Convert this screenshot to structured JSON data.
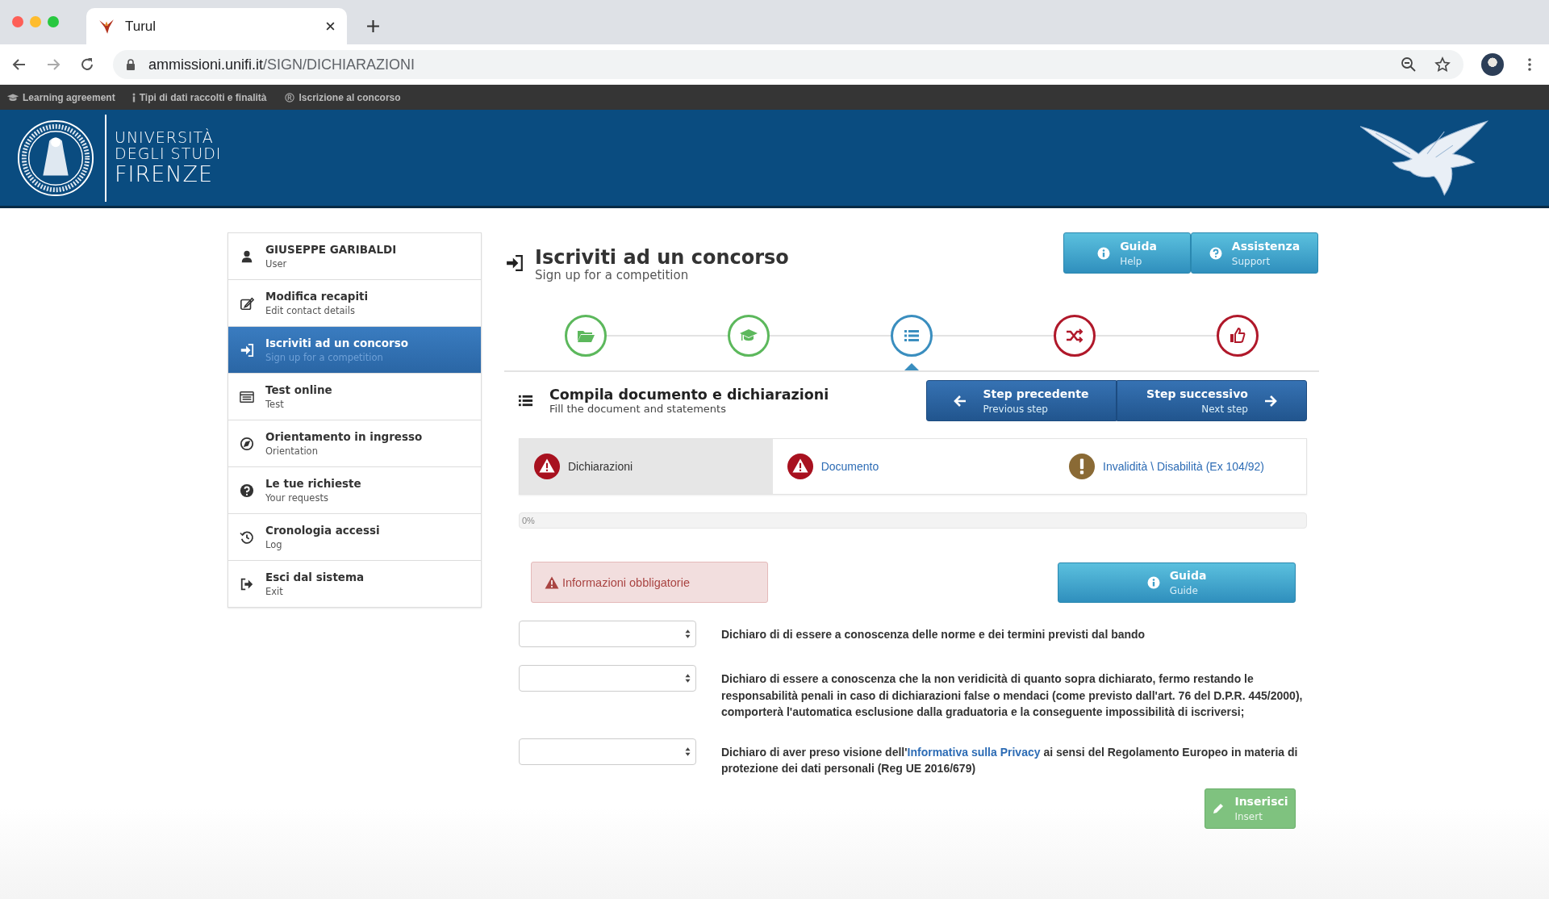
{
  "browser": {
    "tab_title": "Turul",
    "url_host": "ammissioni.unifi.it",
    "url_path": "/SIGN/DICHIARAZIONI"
  },
  "bookmarks": [
    "Learning agreement",
    "Tipi di dati raccolti e finalità",
    "Iscrizione al concorso"
  ],
  "logo": {
    "lines": [
      "UNIVERSITÀ",
      "DEGLI STUDI",
      "FIRENZE"
    ]
  },
  "sidebar": {
    "items": [
      {
        "title": "GIUSEPPE GARIBALDI",
        "subtitle": "User",
        "selected": false
      },
      {
        "title": "Modifica recapiti",
        "subtitle": "Edit contact details",
        "selected": false
      },
      {
        "title": "Iscriviti ad un concorso",
        "subtitle": "Sign up for a competition",
        "selected": true
      },
      {
        "title": "Test online",
        "subtitle": "Test",
        "selected": false
      },
      {
        "title": "Orientamento in ingresso",
        "subtitle": "Orientation",
        "selected": false
      },
      {
        "title": "Le tue richieste",
        "subtitle": "Your requests",
        "selected": false
      },
      {
        "title": "Cronologia accessi",
        "subtitle": "Log",
        "selected": false
      },
      {
        "title": "Esci dal sistema",
        "subtitle": "Exit",
        "selected": false
      }
    ]
  },
  "page": {
    "title": "Iscriviti ad un concorso",
    "subtitle": "Sign up for a competition"
  },
  "header_buttons": [
    {
      "label": "Guida",
      "sublabel": "Help"
    },
    {
      "label": "Assistenza",
      "sublabel": "Support"
    }
  ],
  "steps": [
    {
      "color": "#5cb85c",
      "selected": false
    },
    {
      "color": "#5cb85c",
      "selected": false
    },
    {
      "color": "#3a8ebf",
      "selected": true
    },
    {
      "color": "#b0182a",
      "selected": false
    },
    {
      "color": "#b0182a",
      "selected": false
    }
  ],
  "section": {
    "title": "Compila documento e dichiarazioni",
    "subtitle": "Fill the document and statements"
  },
  "nav_buttons": [
    {
      "label": "Step precedente",
      "sublabel": "Previous step"
    },
    {
      "label": "Step successivo",
      "sublabel": "Next step"
    }
  ],
  "tabs": [
    {
      "label": "Dichiarazioni",
      "selected": true,
      "kind": "error"
    },
    {
      "label": "Documento",
      "selected": false,
      "kind": "error"
    },
    {
      "label": "Invalidità \\ Disabilità (Ex 104/92)",
      "selected": false,
      "kind": "warning"
    }
  ],
  "progress": {
    "level": 0,
    "reading": "0%"
  },
  "alert": "Informazioni obbligatorie",
  "guide_button": {
    "label": "Guida",
    "sublabel": "Guide"
  },
  "declarations": [
    {
      "text": "Dichiaro di di essere a conoscenza delle norme e dei termini previsti dal bando"
    },
    {
      "text": "Dichiaro di essere a conoscenza che la non veridicità di quanto sopra dichiarato, fermo restando le responsabilità penali in caso di dichiarazioni false o mendaci (come previsto dall'art. 76 del D.P.R. 445/2000), comporterà l'automatica esclusione dalla graduatoria e la conseguente impossibilità di iscriversi;"
    },
    {
      "text": "Dichiaro di aver preso visione dell'",
      "link": "Informativa sulla Privacy",
      "text_after": " ai sensi del Regolamento Europeo in materia di protezione dei dati personali (Reg UE 2016/679)"
    }
  ],
  "insert_button": {
    "label": "Inserisci",
    "sublabel": "Insert"
  }
}
